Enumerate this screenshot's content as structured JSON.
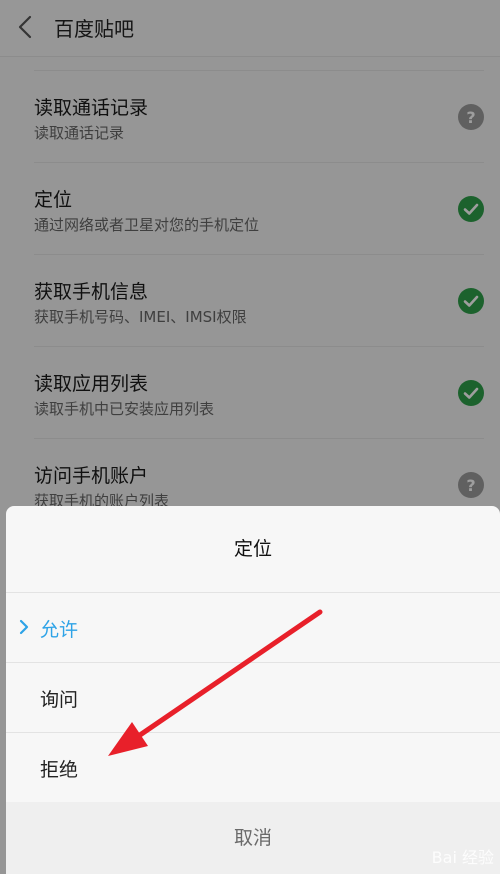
{
  "header": {
    "title": "百度贴吧",
    "back_icon": "chevron-left-icon"
  },
  "permissions": [
    {
      "title": "读取通话记录",
      "subtitle": "读取通话记录",
      "status_icon": "question-icon"
    },
    {
      "title": "定位",
      "subtitle": "通过网络或者卫星对您的手机定位",
      "status_icon": "check-icon"
    },
    {
      "title": "获取手机信息",
      "subtitle": "获取手机号码、IMEI、IMSI权限",
      "status_icon": "check-icon"
    },
    {
      "title": "读取应用列表",
      "subtitle": "读取手机中已安装应用列表",
      "status_icon": "check-icon"
    },
    {
      "title": "访问手机账户",
      "subtitle": "获取手机的账户列表",
      "status_icon": "question-icon"
    }
  ],
  "dialog": {
    "title": "定位",
    "options": [
      {
        "label": "允许",
        "selected": true
      },
      {
        "label": "询问",
        "selected": false
      },
      {
        "label": "拒绝",
        "selected": false
      }
    ],
    "cancel_label": "取消"
  },
  "watermark": "Bai 经验",
  "colors": {
    "accent": "#2ea3e7",
    "check": "#2e9e4a",
    "question": "#9b9b9b",
    "arrow": "#e8202a"
  }
}
